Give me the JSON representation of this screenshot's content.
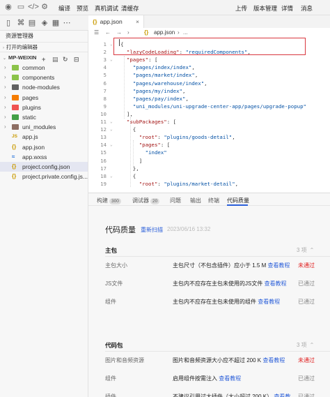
{
  "toolbar": {
    "compile": "编译",
    "preview": "预览",
    "real_debug": "真机调试",
    "clear_cache": "清缓存",
    "upload": "上传",
    "version_mgmt": "版本管理",
    "details": "详情",
    "messages": "消息"
  },
  "sidebar": {
    "title": "资源管理器",
    "open_editors": "打开的编辑器",
    "project": "MP-WEIXIN",
    "items": [
      {
        "label": "common",
        "type": "folder",
        "color": "#8bc34a"
      },
      {
        "label": "components",
        "type": "folder",
        "color": "#8bc34a"
      },
      {
        "label": "node-modules",
        "type": "folder",
        "color": "#616161"
      },
      {
        "label": "pages",
        "type": "folder",
        "color": "#f57c00"
      },
      {
        "label": "plugins",
        "type": "folder",
        "color": "#ef5350"
      },
      {
        "label": "static",
        "type": "folder",
        "color": "#43a047"
      },
      {
        "label": "uni_modules",
        "type": "folder",
        "color": "#8d6e63"
      },
      {
        "label": "app.js",
        "type": "js"
      },
      {
        "label": "app.json",
        "type": "json"
      },
      {
        "label": "app.wxss",
        "type": "wxss"
      },
      {
        "label": "project.config.json",
        "type": "json"
      },
      {
        "label": "project.private.config.js...",
        "type": "json"
      }
    ]
  },
  "editor": {
    "tab_label": "app.json",
    "breadcrumb_file": "app.json",
    "breadcrumb_more": "...",
    "lines": [
      {
        "n": "1",
        "fold": "⌄",
        "code": "{"
      },
      {
        "n": "2",
        "fold": "",
        "code": "  \"lazyCodeLoading\": \"requiredComponents\","
      },
      {
        "n": "3",
        "fold": "⌄",
        "code": "  \"pages\": ["
      },
      {
        "n": "4",
        "fold": "",
        "code": "    \"pages/index/index\","
      },
      {
        "n": "5",
        "fold": "",
        "code": "    \"pages/market/index\","
      },
      {
        "n": "6",
        "fold": "",
        "code": "    \"pages/warehouse/index\","
      },
      {
        "n": "7",
        "fold": "",
        "code": "    \"pages/my/index\","
      },
      {
        "n": "8",
        "fold": "",
        "code": "    \"pages/pay/index\","
      },
      {
        "n": "9",
        "fold": "",
        "code": "    \"uni_modules/uni-upgrade-center-app/pages/upgrade-popup\""
      },
      {
        "n": "10",
        "fold": "",
        "code": "  ],"
      },
      {
        "n": "11",
        "fold": "⌄",
        "code": "  \"subPackages\": ["
      },
      {
        "n": "12",
        "fold": "⌄",
        "code": "    {"
      },
      {
        "n": "13",
        "fold": "",
        "code": "      \"root\": \"plugins/goods-detail\","
      },
      {
        "n": "14",
        "fold": "⌄",
        "code": "      \"pages\": ["
      },
      {
        "n": "15",
        "fold": "",
        "code": "        \"index\""
      },
      {
        "n": "16",
        "fold": "",
        "code": "      ]"
      },
      {
        "n": "17",
        "fold": "",
        "code": "    },"
      },
      {
        "n": "18",
        "fold": "⌄",
        "code": "    {"
      },
      {
        "n": "19",
        "fold": "",
        "code": "      \"root\": \"plugins/market-detail\","
      }
    ]
  },
  "panel_tabs": [
    {
      "label": "构建",
      "badge": "300"
    },
    {
      "label": "调试器",
      "badge": "20"
    },
    {
      "label": "问题",
      "badge": ""
    },
    {
      "label": "输出",
      "badge": ""
    },
    {
      "label": "终端",
      "badge": ""
    },
    {
      "label": "代码质量",
      "badge": ""
    }
  ],
  "quality": {
    "title": "代码质量",
    "rescan": "重新扫描",
    "time": "2023/06/16 13:32",
    "sections": [
      {
        "title": "主包",
        "count": "3 项",
        "rows": [
          {
            "name": "主包大小",
            "desc": "主包尺寸（不包含插件）应小于 1.5 M",
            "link": "查看教程",
            "status": "未通过",
            "fail": true
          },
          {
            "name": "JS文件",
            "desc": "主包内不应存在主包未使用的JS文件",
            "link": "查看教程",
            "status": "已通过",
            "fail": false
          },
          {
            "name": "组件",
            "desc": "主包内不应存在主包未使用的组件",
            "link": "查看教程",
            "status": "已通过",
            "fail": false
          }
        ]
      },
      {
        "title": "代码包",
        "count": "3 项",
        "rows": [
          {
            "name": "图片和音频资源",
            "desc": "图片和音频资源大小应不超过 200 K",
            "link": "查看教程",
            "status": "未通过",
            "fail": true
          },
          {
            "name": "组件",
            "desc": "启用组件按需注入",
            "link": "查看教程",
            "status": "已通过",
            "fail": false
          },
          {
            "name": "插件",
            "desc": "不建议引用过大插件（大小超过 200 K）",
            "link": "查看教程",
            "status": "已通过",
            "fail": false
          }
        ]
      }
    ]
  },
  "colors": {
    "accent": "#2b5fd9",
    "fail": "#e02020",
    "highlight_box": "#d9363e"
  }
}
